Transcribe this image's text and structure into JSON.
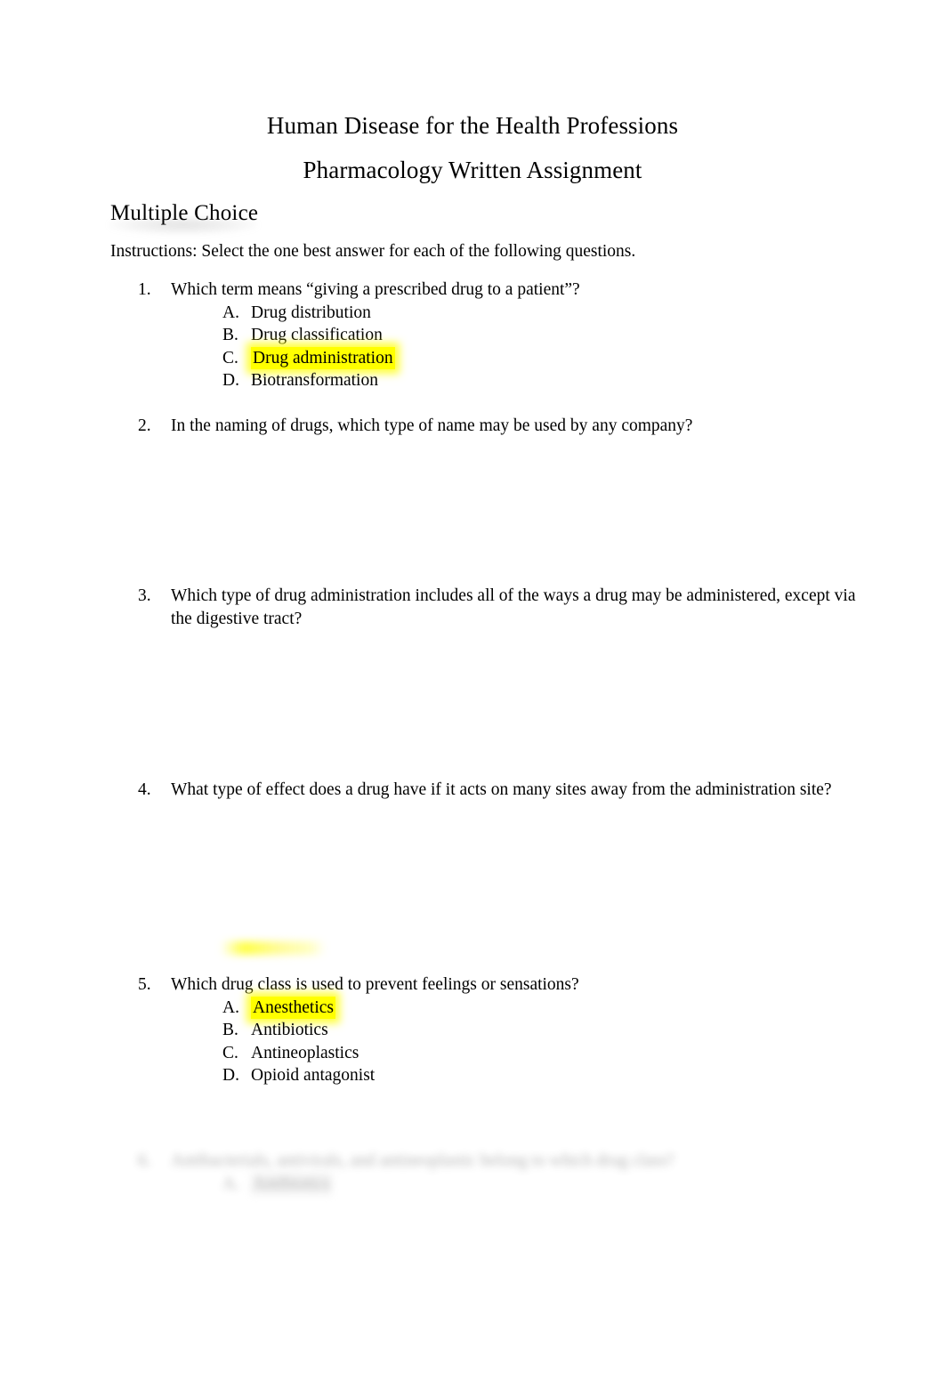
{
  "document": {
    "title_line_1": "Human Disease for the Health Professions",
    "title_line_2": "Pharmacology Written Assignment",
    "section_heading": "Multiple Choice",
    "instructions": "Instructions:  Select the one best answer for each of the following questions."
  },
  "colors": {
    "highlight_yellow": "#ffff00",
    "page_background": "#ffffff",
    "text": "#000000"
  },
  "questions": [
    {
      "number": "1.",
      "text": "Which term means “giving a prescribed drug to a patient”?",
      "options": [
        {
          "letter": "A.",
          "text": "Drug distribution",
          "highlighted": false
        },
        {
          "letter": "B.",
          "text": "Drug classification",
          "highlighted": false
        },
        {
          "letter": "C.",
          "text": "Drug administration",
          "highlighted": true
        },
        {
          "letter": "D.",
          "text": "Biotransformation",
          "highlighted": false
        }
      ]
    },
    {
      "number": "2.",
      "text": "In the naming of drugs, which type of name may be used by any company?",
      "options": []
    },
    {
      "number": "3.",
      "text": "Which type of drug administration includes all of the ways a drug may be administered, except via the digestive tract?",
      "options": []
    },
    {
      "number": "4.",
      "text": "What type of effect does a drug have if it acts on many sites away from the administration site?",
      "options": []
    },
    {
      "number": "5.",
      "text": "Which drug class is used to prevent feelings or sensations?",
      "options": [
        {
          "letter": "A.",
          "text": "Anesthetics",
          "highlighted": true
        },
        {
          "letter": "B.",
          "text": "Antibiotics",
          "highlighted": false
        },
        {
          "letter": "C.",
          "text": "Antineoplastics",
          "highlighted": false
        },
        {
          "letter": "D.",
          "text": "Opioid antagonist",
          "highlighted": false
        }
      ]
    }
  ],
  "obscured_question": {
    "number": "6.",
    "text": "Antibacterials, antivirals, and antineoplastic belong to which drug class?",
    "options": [
      {
        "letter": "A.",
        "text": "Antibiotics",
        "highlighted": true
      }
    ],
    "legible": false
  }
}
